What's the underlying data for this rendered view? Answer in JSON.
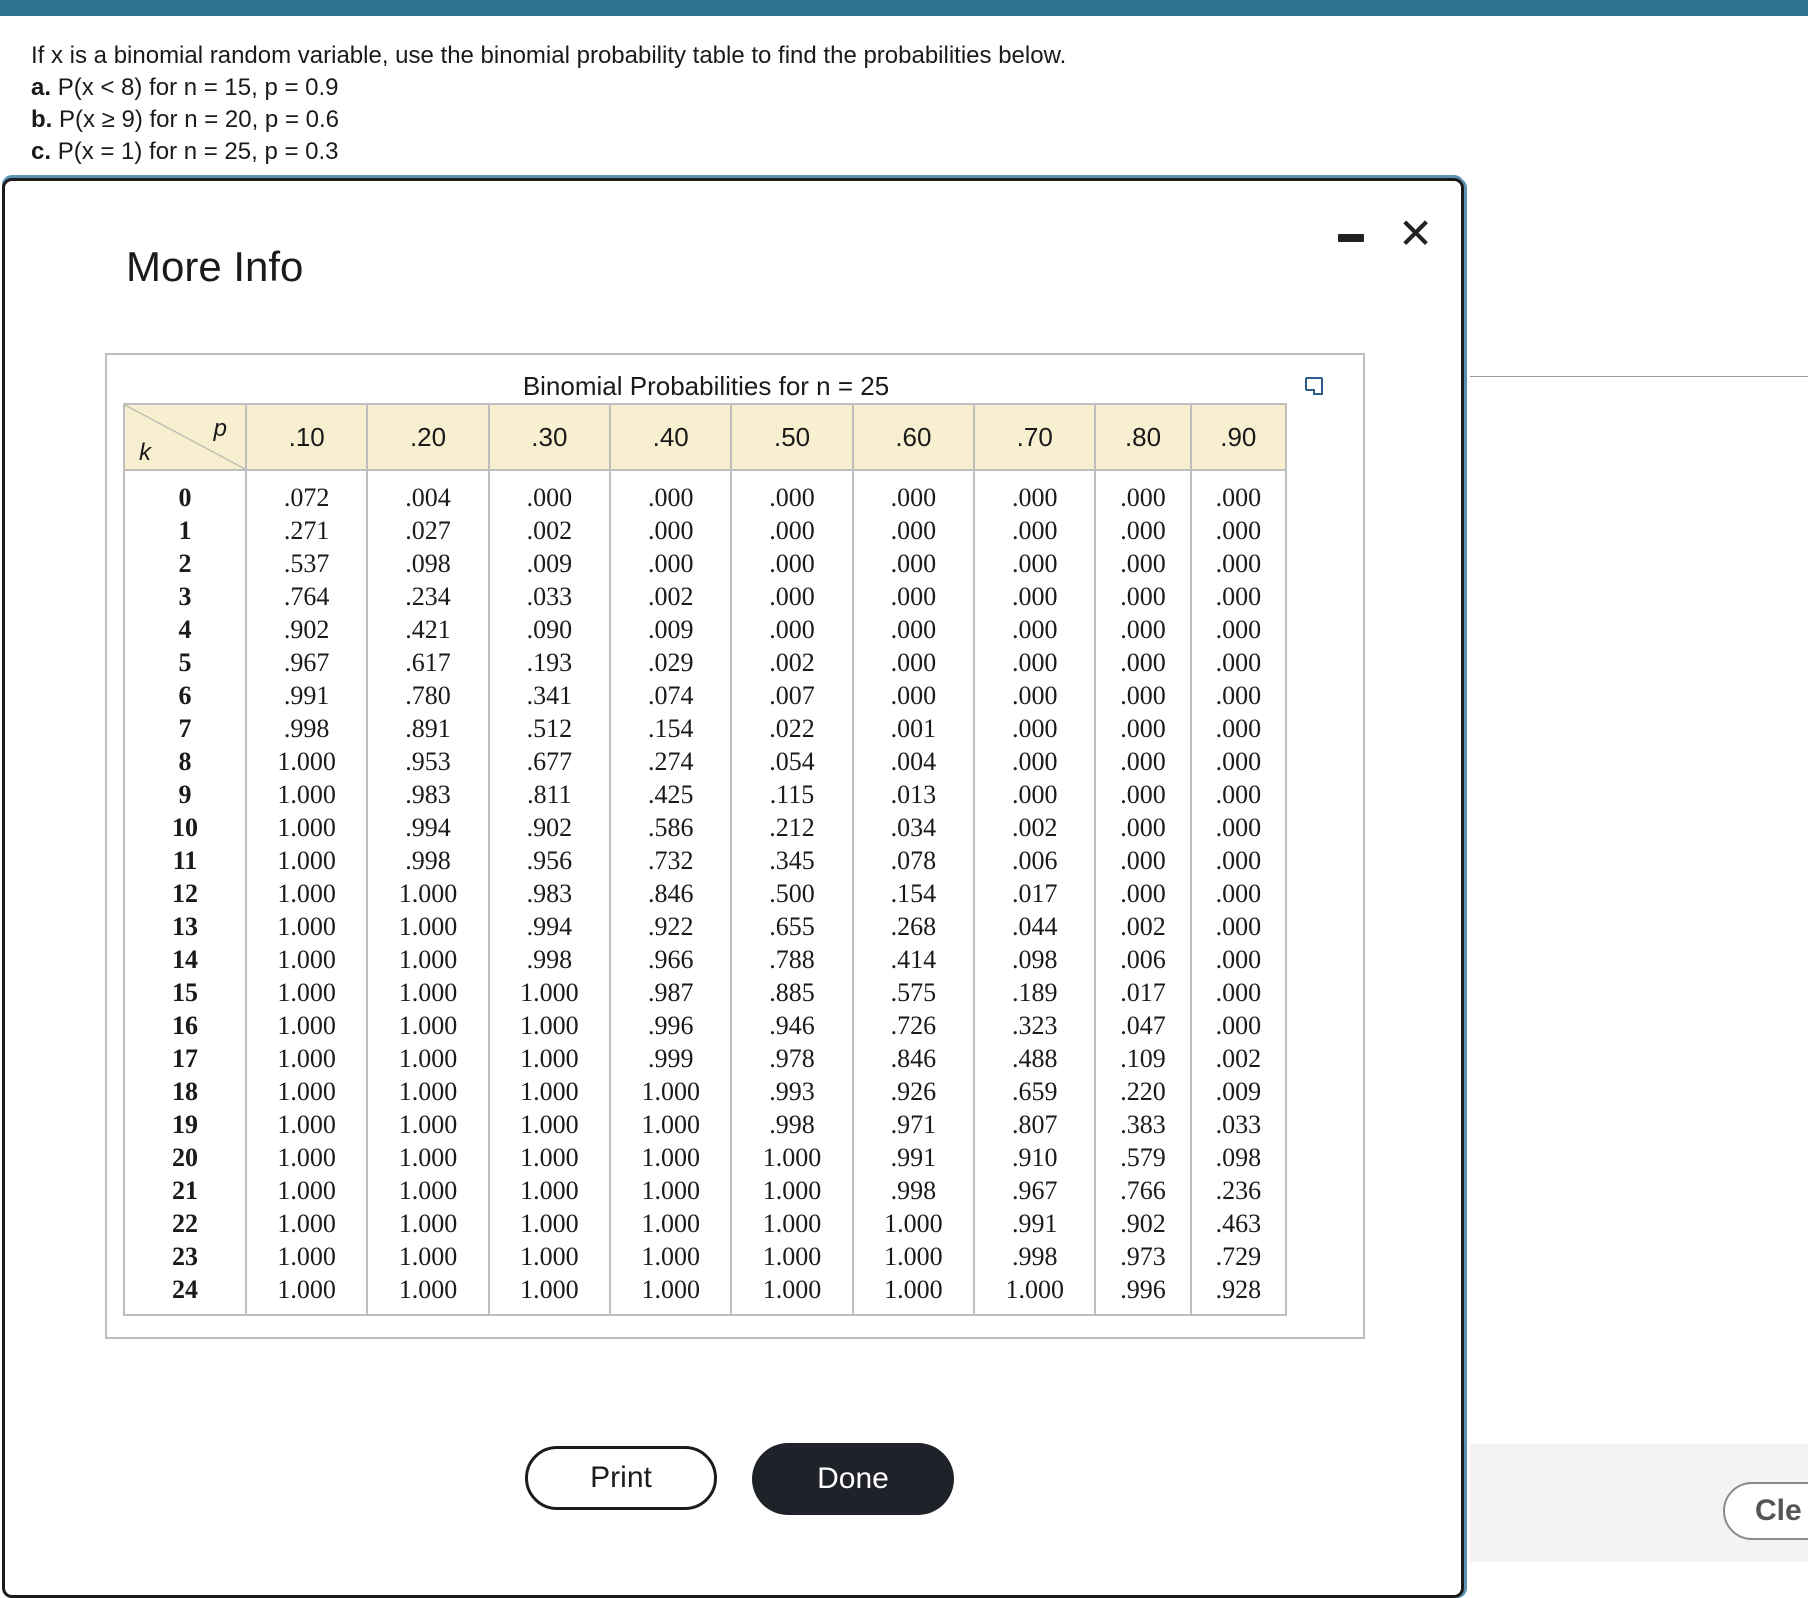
{
  "question": {
    "intro": "If x is a binomial random variable, use the binomial probability table to find the probabilities below.",
    "parts": [
      {
        "label": "a.",
        "text": "P(x < 8) for n = 15, p = 0.9"
      },
      {
        "label": "b.",
        "text": "P(x ≥ 9) for n = 20, p = 0.6"
      },
      {
        "label": "c.",
        "text": "P(x = 1) for n = 25, p = 0.3"
      }
    ]
  },
  "modal": {
    "title": "More Info",
    "minimize_icon": "minimize-icon",
    "close_icon": "close-icon",
    "close_glyph": "✕"
  },
  "table": {
    "title": "Binomial Probabilities for n = 25",
    "p_label": "p",
    "k_label": "k",
    "p_values": [
      ".10",
      ".20",
      ".30",
      ".40",
      ".50",
      ".60",
      ".70",
      ".80",
      ".90"
    ],
    "rows": [
      {
        "k": "0",
        "v": [
          ".072",
          ".004",
          ".000",
          ".000",
          ".000",
          ".000",
          ".000",
          ".000",
          ".000"
        ]
      },
      {
        "k": "1",
        "v": [
          ".271",
          ".027",
          ".002",
          ".000",
          ".000",
          ".000",
          ".000",
          ".000",
          ".000"
        ]
      },
      {
        "k": "2",
        "v": [
          ".537",
          ".098",
          ".009",
          ".000",
          ".000",
          ".000",
          ".000",
          ".000",
          ".000"
        ]
      },
      {
        "k": "3",
        "v": [
          ".764",
          ".234",
          ".033",
          ".002",
          ".000",
          ".000",
          ".000",
          ".000",
          ".000"
        ]
      },
      {
        "k": "4",
        "v": [
          ".902",
          ".421",
          ".090",
          ".009",
          ".000",
          ".000",
          ".000",
          ".000",
          ".000"
        ]
      },
      {
        "k": "5",
        "v": [
          ".967",
          ".617",
          ".193",
          ".029",
          ".002",
          ".000",
          ".000",
          ".000",
          ".000"
        ]
      },
      {
        "k": "6",
        "v": [
          ".991",
          ".780",
          ".341",
          ".074",
          ".007",
          ".000",
          ".000",
          ".000",
          ".000"
        ]
      },
      {
        "k": "7",
        "v": [
          ".998",
          ".891",
          ".512",
          ".154",
          ".022",
          ".001",
          ".000",
          ".000",
          ".000"
        ]
      },
      {
        "k": "8",
        "v": [
          "1.000",
          ".953",
          ".677",
          ".274",
          ".054",
          ".004",
          ".000",
          ".000",
          ".000"
        ]
      },
      {
        "k": "9",
        "v": [
          "1.000",
          ".983",
          ".811",
          ".425",
          ".115",
          ".013",
          ".000",
          ".000",
          ".000"
        ]
      },
      {
        "k": "10",
        "v": [
          "1.000",
          ".994",
          ".902",
          ".586",
          ".212",
          ".034",
          ".002",
          ".000",
          ".000"
        ]
      },
      {
        "k": "11",
        "v": [
          "1.000",
          ".998",
          ".956",
          ".732",
          ".345",
          ".078",
          ".006",
          ".000",
          ".000"
        ]
      },
      {
        "k": "12",
        "v": [
          "1.000",
          "1.000",
          ".983",
          ".846",
          ".500",
          ".154",
          ".017",
          ".000",
          ".000"
        ]
      },
      {
        "k": "13",
        "v": [
          "1.000",
          "1.000",
          ".994",
          ".922",
          ".655",
          ".268",
          ".044",
          ".002",
          ".000"
        ]
      },
      {
        "k": "14",
        "v": [
          "1.000",
          "1.000",
          ".998",
          ".966",
          ".788",
          ".414",
          ".098",
          ".006",
          ".000"
        ]
      },
      {
        "k": "15",
        "v": [
          "1.000",
          "1.000",
          "1.000",
          ".987",
          ".885",
          ".575",
          ".189",
          ".017",
          ".000"
        ]
      },
      {
        "k": "16",
        "v": [
          "1.000",
          "1.000",
          "1.000",
          ".996",
          ".946",
          ".726",
          ".323",
          ".047",
          ".000"
        ]
      },
      {
        "k": "17",
        "v": [
          "1.000",
          "1.000",
          "1.000",
          ".999",
          ".978",
          ".846",
          ".488",
          ".109",
          ".002"
        ]
      },
      {
        "k": "18",
        "v": [
          "1.000",
          "1.000",
          "1.000",
          "1.000",
          ".993",
          ".926",
          ".659",
          ".220",
          ".009"
        ]
      },
      {
        "k": "19",
        "v": [
          "1.000",
          "1.000",
          "1.000",
          "1.000",
          ".998",
          ".971",
          ".807",
          ".383",
          ".033"
        ]
      },
      {
        "k": "20",
        "v": [
          "1.000",
          "1.000",
          "1.000",
          "1.000",
          "1.000",
          ".991",
          ".910",
          ".579",
          ".098"
        ]
      },
      {
        "k": "21",
        "v": [
          "1.000",
          "1.000",
          "1.000",
          "1.000",
          "1.000",
          ".998",
          ".967",
          ".766",
          ".236"
        ]
      },
      {
        "k": "22",
        "v": [
          "1.000",
          "1.000",
          "1.000",
          "1.000",
          "1.000",
          "1.000",
          ".991",
          ".902",
          ".463"
        ]
      },
      {
        "k": "23",
        "v": [
          "1.000",
          "1.000",
          "1.000",
          "1.000",
          "1.000",
          "1.000",
          ".998",
          ".973",
          ".729"
        ]
      },
      {
        "k": "24",
        "v": [
          "1.000",
          "1.000",
          "1.000",
          "1.000",
          "1.000",
          "1.000",
          "1.000",
          ".996",
          ".928"
        ]
      }
    ]
  },
  "buttons": {
    "print": "Print",
    "done": "Done",
    "clear": "Cle"
  },
  "colors": {
    "top_bar": "#2f7191",
    "header_fill": "#f8efd1",
    "done_button": "#1f2229"
  }
}
